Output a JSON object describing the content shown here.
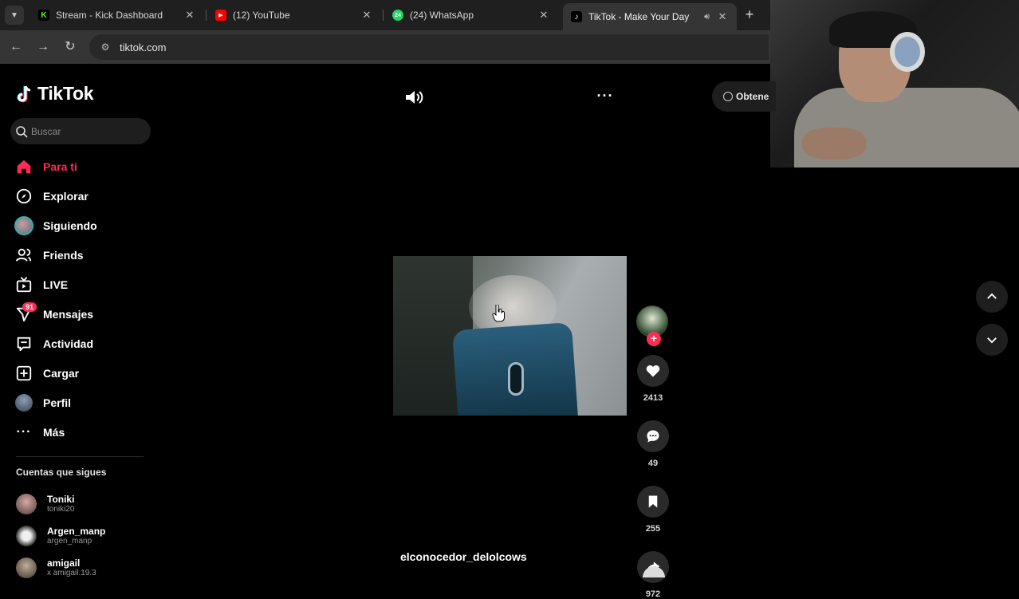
{
  "browser": {
    "tabs": [
      {
        "title": "Stream - Kick Dashboard",
        "favicon": "kick-icon",
        "color": "#53fc18"
      },
      {
        "title": "(12) YouTube",
        "favicon": "youtube-icon",
        "color": "#ff0000"
      },
      {
        "title": "(24) WhatsApp",
        "favicon": "whatsapp-icon",
        "color": "#25d366",
        "badge": "24"
      },
      {
        "title": "TikTok - Make Your Day",
        "favicon": "tiktok-icon",
        "active": true
      }
    ],
    "url": "tiktok.com"
  },
  "app": {
    "brand": "TikTok",
    "search_placeholder": "Buscar",
    "get_app_label": "Obtene",
    "nav": [
      {
        "label": "Para ti",
        "icon": "home-icon",
        "active": true
      },
      {
        "label": "Explorar",
        "icon": "compass-icon"
      },
      {
        "label": "Siguiendo",
        "icon": "following-avatar"
      },
      {
        "label": "Friends",
        "icon": "friends-icon"
      },
      {
        "label": "LIVE",
        "icon": "live-icon"
      },
      {
        "label": "Mensajes",
        "icon": "messages-icon",
        "badge": "91"
      },
      {
        "label": "Actividad",
        "icon": "activity-icon"
      },
      {
        "label": "Cargar",
        "icon": "upload-icon"
      },
      {
        "label": "Perfil",
        "icon": "profile-avatar"
      },
      {
        "label": "Más",
        "icon": "more-icon"
      }
    ],
    "following_title": "Cuentas que sigues",
    "following": [
      {
        "name": "Toniki",
        "handle": "toniki20"
      },
      {
        "name": "Argen_manp",
        "handle": "argen_manp"
      },
      {
        "name": "amigail",
        "handle": "x amigail.19.3"
      }
    ]
  },
  "video": {
    "author": "elconocedor_delolcows",
    "likes": "2413",
    "comments": "49",
    "saves": "255",
    "shares": "972"
  },
  "colors": {
    "accent": "#fe2c55",
    "background": "#000000"
  }
}
